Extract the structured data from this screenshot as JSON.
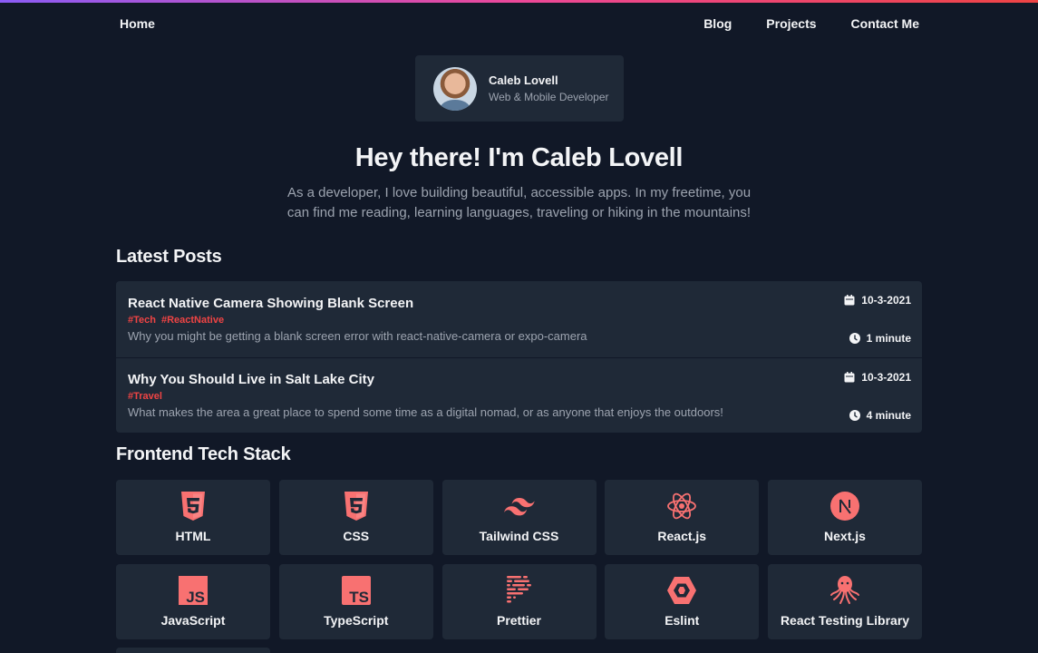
{
  "nav": {
    "home": "Home",
    "blog": "Blog",
    "projects": "Projects",
    "contact": "Contact Me"
  },
  "profile": {
    "name": "Caleb Lovell",
    "role": "Web & Mobile Developer"
  },
  "hero": {
    "title": "Hey there! I'm Caleb Lovell",
    "text": "As a developer, I love building beautiful, accessible apps. In my freetime, you can find me reading, learning languages, traveling or hiking in the mountains!"
  },
  "sections": {
    "posts": "Latest Posts",
    "tech": "Frontend Tech Stack"
  },
  "posts": [
    {
      "title": "React Native Camera Showing Blank Screen",
      "tags": [
        "#Tech",
        "#ReactNative"
      ],
      "description": "Why you might be getting a blank screen error with react-native-camera or expo-camera",
      "date": "10-3-2021",
      "read_time": "1 minute"
    },
    {
      "title": "Why You Should Live in Salt Lake City",
      "tags": [
        "#Travel"
      ],
      "description": "What makes the area a great place to spend some time as a digital nomad, or as anyone that enjoys the outdoors!",
      "date": "10-3-2021",
      "read_time": "4 minute"
    }
  ],
  "tech": [
    {
      "label": "HTML",
      "icon": "html5-icon"
    },
    {
      "label": "CSS",
      "icon": "css3-icon"
    },
    {
      "label": "Tailwind CSS",
      "icon": "tailwind-icon"
    },
    {
      "label": "React.js",
      "icon": "react-icon"
    },
    {
      "label": "Next.js",
      "icon": "nextjs-icon"
    },
    {
      "label": "JavaScript",
      "icon": "javascript-icon"
    },
    {
      "label": "TypeScript",
      "icon": "typescript-icon"
    },
    {
      "label": "Prettier",
      "icon": "prettier-icon"
    },
    {
      "label": "Eslint",
      "icon": "eslint-icon"
    },
    {
      "label": "React Testing Library",
      "icon": "octopus-icon"
    }
  ],
  "colors": {
    "background": "#111827",
    "card": "#1f2937",
    "accent": "#ef4444",
    "icon": "#f87171",
    "muted": "#9ca3af"
  }
}
